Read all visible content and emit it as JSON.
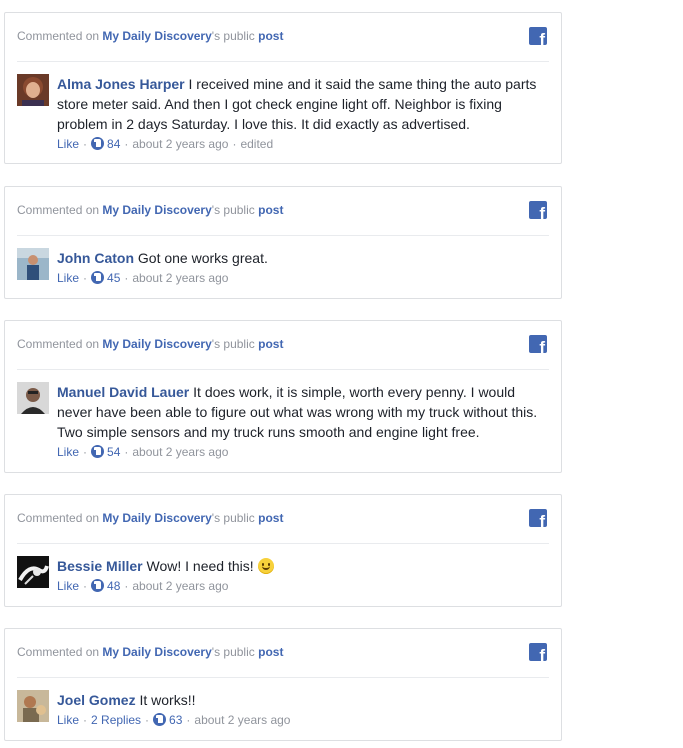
{
  "header": {
    "prefix": "Commented on",
    "page_name": "My Daily Discovery",
    "suffix": "'s public",
    "post_link": "post",
    "icon": "facebook-icon"
  },
  "meta": {
    "like_label": "Like",
    "time_label": "about 2 years ago",
    "edited_label": "edited",
    "replies_label": "2 Replies"
  },
  "comments": [
    {
      "author": "Alma Jones Harper",
      "text": "I received mine and it said the same thing the auto parts store meter said. And then I got check engine light off. Neighbor is fixing problem in 2 days Saturday. I love this. It did exactly as advertised.",
      "likes": "84"
    },
    {
      "author": "John Caton",
      "text": "Got one works great.",
      "likes": "45"
    },
    {
      "author": "Manuel David Lauer",
      "text": "It does work, it is simple, worth every penny. I would never have been able to figure out what was wrong with my truck without this. Two simple sensors and my truck runs smooth and engine light free.",
      "likes": "54"
    },
    {
      "author": "Bessie Miller",
      "text": "Wow! I need this!",
      "likes": "48",
      "emoji": "smiley-emoji"
    },
    {
      "author": "Joel Gomez",
      "text": "It works!!",
      "likes": "63"
    }
  ]
}
